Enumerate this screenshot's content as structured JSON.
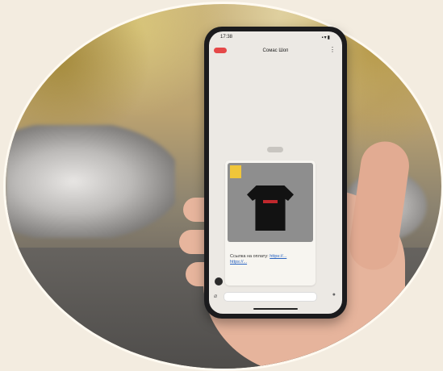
{
  "scene": {
    "status_time": "17:38",
    "status_icons": "▪▾▮",
    "chat_title": "Сомас Шоп",
    "back_label": "",
    "more_icon": "ellipsis-icon",
    "photo_tag": "",
    "brand_name": "",
    "brand_sub": "",
    "message_text": "Ссылка на оплату:",
    "message_links": [
      "https://...",
      "https://..."
    ],
    "input_placeholder": "",
    "attach_icon": "paperclip-icon",
    "mic_icon": "microphone-icon"
  },
  "colors": {
    "background": "#f3ece0",
    "phone_body": "#1b1b1d",
    "screen": "#ece9e4",
    "accent_red": "#e54848",
    "link_blue": "#2a64c2"
  }
}
